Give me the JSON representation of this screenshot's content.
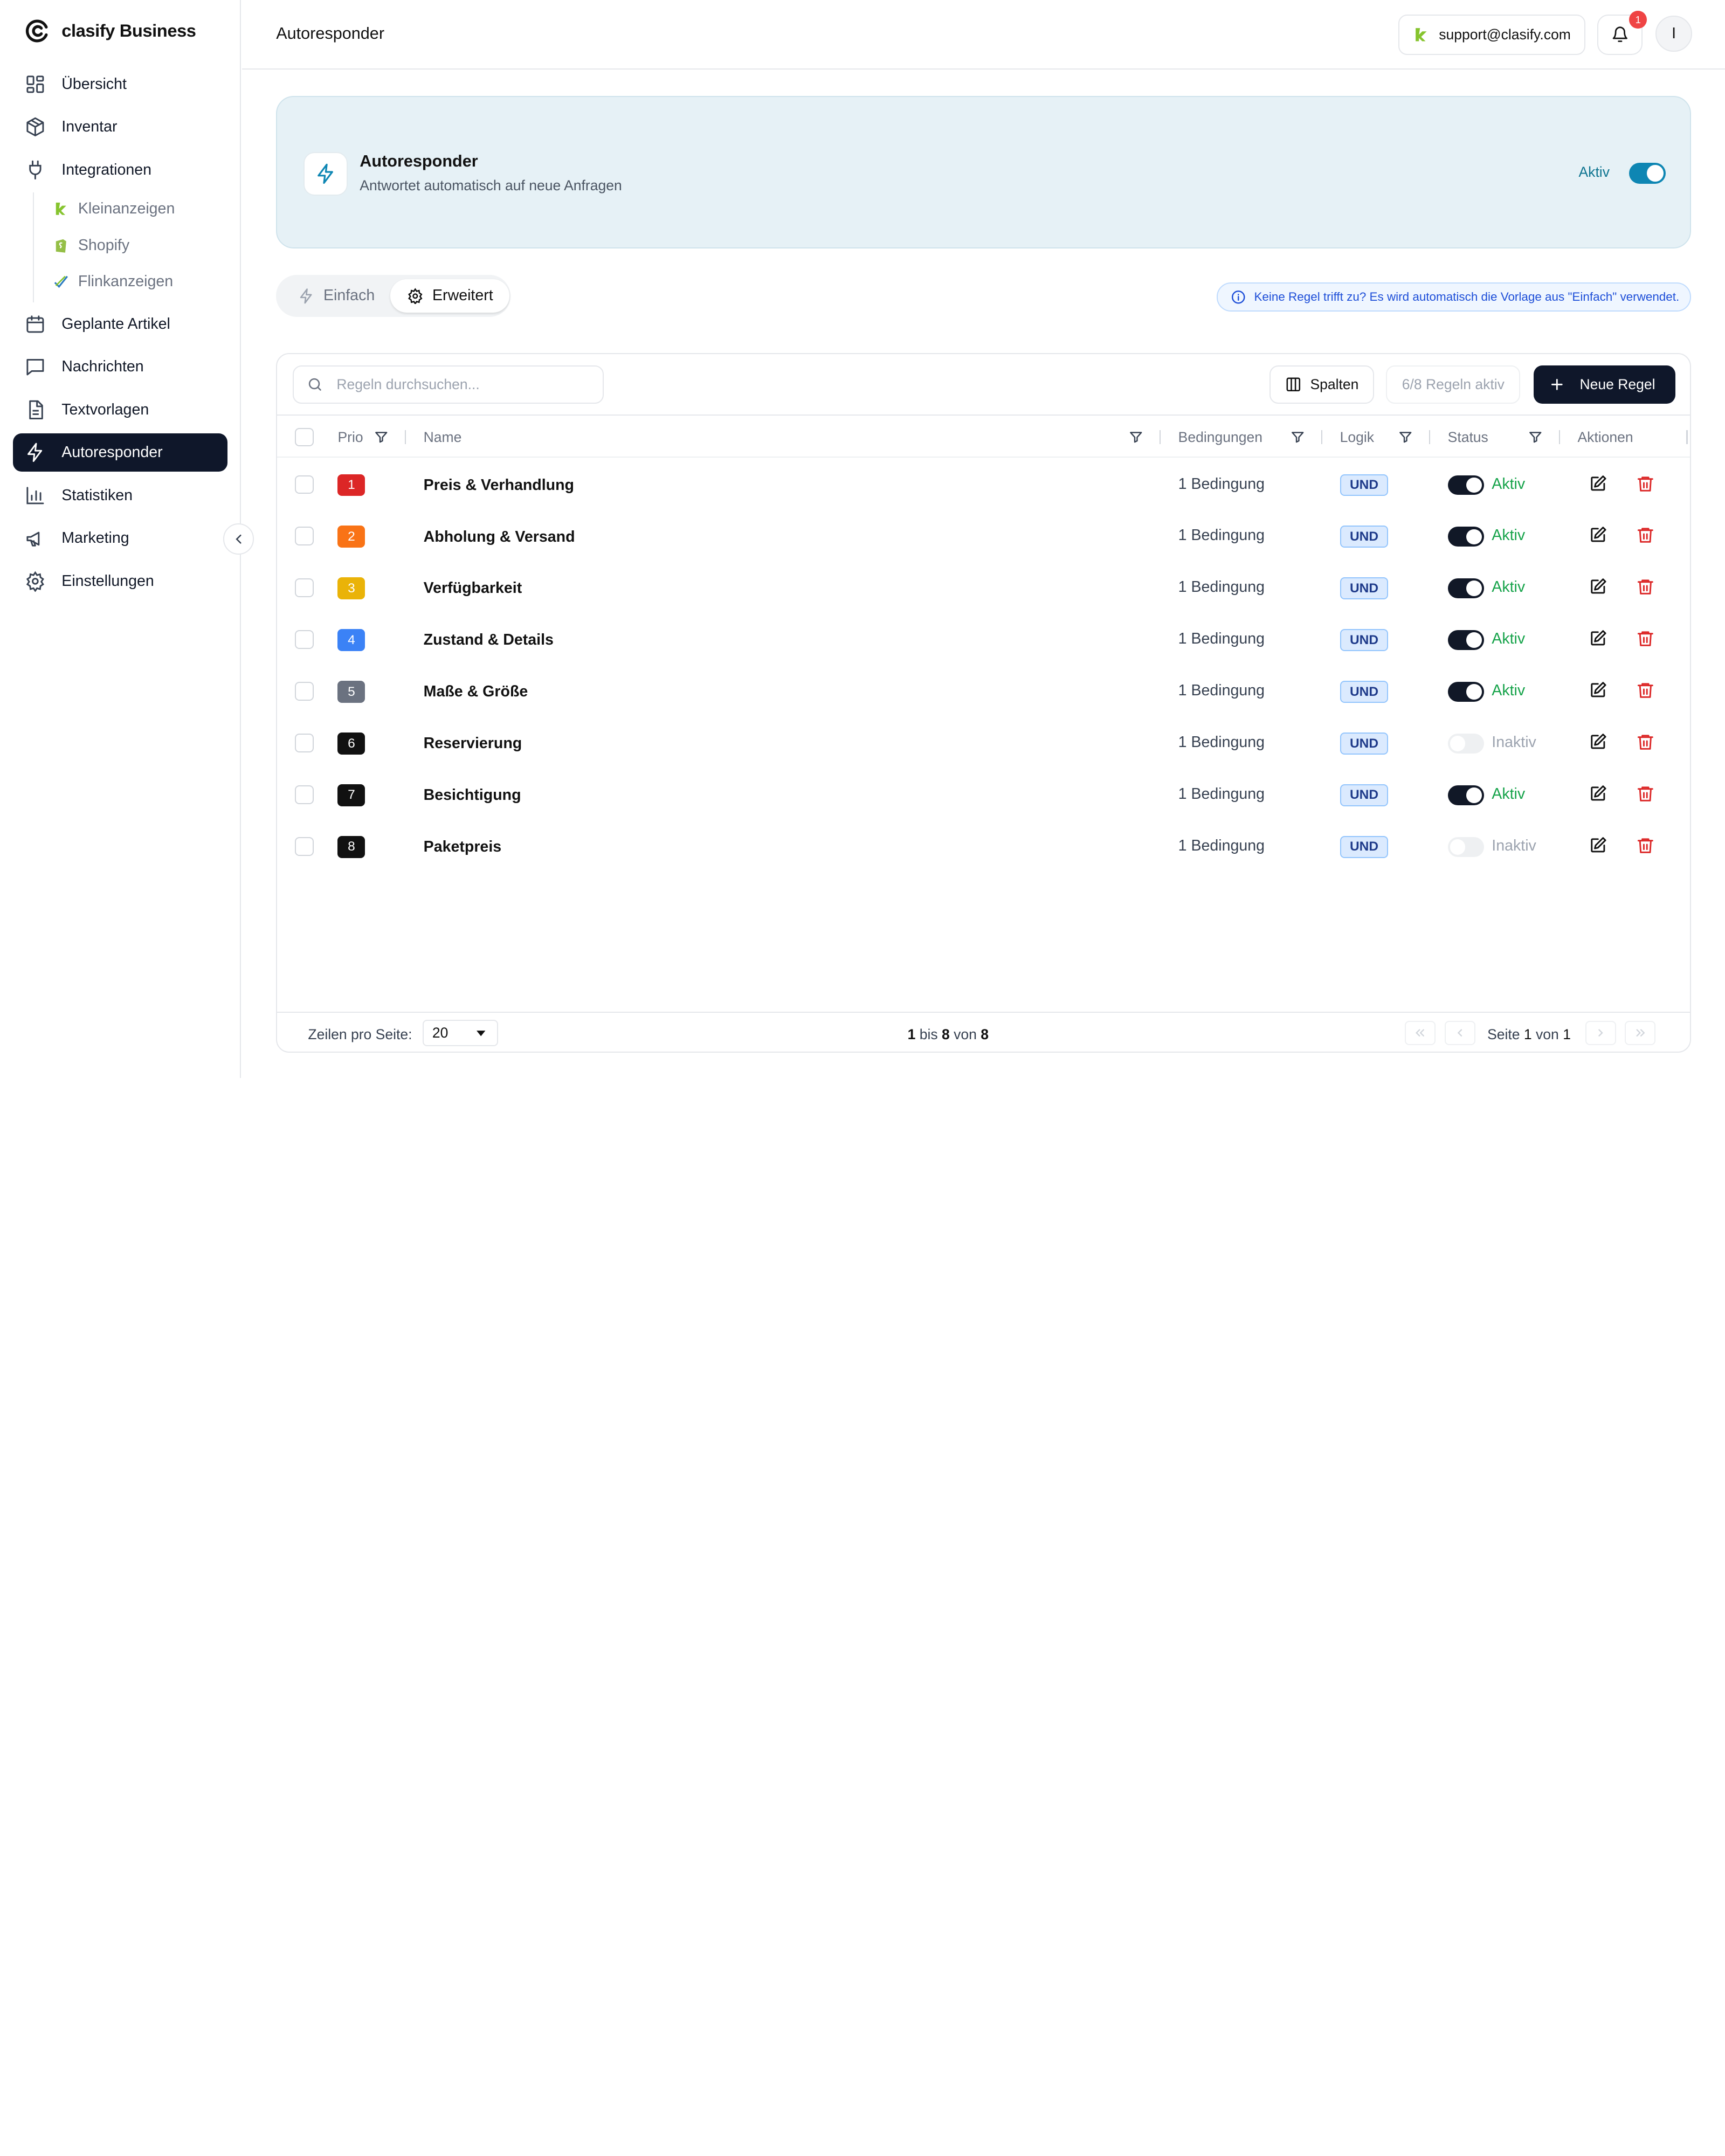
{
  "brand": {
    "name": "clasify Business"
  },
  "sidebar": {
    "items": [
      {
        "label": "Übersicht",
        "icon": "grid-icon"
      },
      {
        "label": "Inventar",
        "icon": "package-icon"
      },
      {
        "label": "Integrationen",
        "icon": "plug-icon"
      },
      {
        "label": "Geplante Artikel",
        "icon": "calendar-icon"
      },
      {
        "label": "Nachrichten",
        "icon": "message-icon"
      },
      {
        "label": "Textvorlagen",
        "icon": "document-icon"
      },
      {
        "label": "Autoresponder",
        "icon": "bolt-icon",
        "active": true
      },
      {
        "label": "Statistiken",
        "icon": "bar-chart-icon"
      },
      {
        "label": "Marketing",
        "icon": "megaphone-icon"
      },
      {
        "label": "Einstellungen",
        "icon": "gear-icon"
      }
    ],
    "subitems": [
      {
        "label": "Kleinanzeigen",
        "icon": "kleinanzeigen-logo-icon"
      },
      {
        "label": "Shopify",
        "icon": "shopify-logo-icon"
      },
      {
        "label": "Flinkanzeigen",
        "icon": "flinkanzeigen-logo-icon"
      }
    ]
  },
  "header": {
    "title": "Autoresponder",
    "support_email": "support@clasify.com",
    "notification_count": "1",
    "avatar_initial": "I"
  },
  "hero": {
    "title": "Autoresponder",
    "subtitle": "Antwortet automatisch auf neue Anfragen",
    "status_label": "Aktiv",
    "enabled": true
  },
  "mode_tabs": [
    {
      "label": "Einfach",
      "active": false
    },
    {
      "label": "Erweitert",
      "active": true
    }
  ],
  "info_banner": "Keine Regel trifft zu? Es wird automatisch die Vorlage aus \"Einfach\" verwendet.",
  "toolbar": {
    "search_placeholder": "Regeln durchsuchen...",
    "columns_label": "Spalten",
    "active_count": "6/8 Regeln aktiv",
    "new_rule_label": "Neue Regel"
  },
  "table": {
    "headers": {
      "prio": "Prio",
      "name": "Name",
      "conditions": "Bedingungen",
      "logic": "Logik",
      "status": "Status",
      "actions": "Aktionen"
    },
    "rows": [
      {
        "prio": "1",
        "prio_color": "#dc2626",
        "name": "Preis & Verhandlung",
        "conditions": "1 Bedingung",
        "logic": "UND",
        "active": true,
        "status": "Aktiv"
      },
      {
        "prio": "2",
        "prio_color": "#f97316",
        "name": "Abholung & Versand",
        "conditions": "1 Bedingung",
        "logic": "UND",
        "active": true,
        "status": "Aktiv"
      },
      {
        "prio": "3",
        "prio_color": "#eab308",
        "name": "Verfügbarkeit",
        "conditions": "1 Bedingung",
        "logic": "UND",
        "active": true,
        "status": "Aktiv"
      },
      {
        "prio": "4",
        "prio_color": "#3b82f6",
        "name": "Zustand & Details",
        "conditions": "1 Bedingung",
        "logic": "UND",
        "active": true,
        "status": "Aktiv"
      },
      {
        "prio": "5",
        "prio_color": "#6b7280",
        "name": "Maße & Größe",
        "conditions": "1 Bedingung",
        "logic": "UND",
        "active": true,
        "status": "Aktiv"
      },
      {
        "prio": "6",
        "prio_color": "#111111",
        "name": "Reservierung",
        "conditions": "1 Bedingung",
        "logic": "UND",
        "active": false,
        "status": "Inaktiv"
      },
      {
        "prio": "7",
        "prio_color": "#111111",
        "name": "Besichtigung",
        "conditions": "1 Bedingung",
        "logic": "UND",
        "active": true,
        "status": "Aktiv"
      },
      {
        "prio": "8",
        "prio_color": "#111111",
        "name": "Paketpreis",
        "conditions": "1 Bedingung",
        "logic": "UND",
        "active": false,
        "status": "Inaktiv"
      }
    ]
  },
  "footer": {
    "rows_per_page_label": "Zeilen pro Seite:",
    "rows_per_page_value": "20",
    "range_from": "1",
    "range_bis": "bis",
    "range_to": "8",
    "range_von": "von",
    "range_total": "8",
    "page_label": "Seite",
    "page_current": "1",
    "page_von": "von",
    "page_total": "1"
  },
  "colors": {
    "sidebar_active": "#0f172a",
    "hero_bg": "#e6f1f6",
    "accent_teal": "#0e86b3",
    "status_active": "#16a34a",
    "status_inactive": "#9ca3af",
    "delete_red": "#dc2626"
  }
}
